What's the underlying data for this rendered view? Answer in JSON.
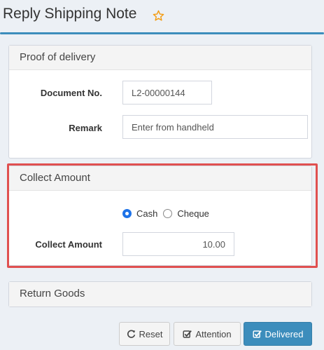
{
  "header": {
    "title": "Reply Shipping Note",
    "favorite_icon": "star-icon"
  },
  "proof": {
    "title": "Proof of delivery",
    "document_no_label": "Document No.",
    "document_no_value": "L2-00000144",
    "remark_label": "Remark",
    "remark_placeholder": "Enter from handheld"
  },
  "collect": {
    "title": "Collect Amount",
    "options": [
      "Cash",
      "Cheque"
    ],
    "selected": "Cash",
    "amount_label": "Collect Amount",
    "amount_value": "10.00"
  },
  "return_goods": {
    "title": "Return Goods"
  },
  "actions": {
    "reset_label": "Reset",
    "attention_label": "Attention",
    "delivered_label": "Delivered"
  },
  "colors": {
    "accent": "#3c8dbc",
    "highlight": "#e05050",
    "favorite": "#f39c12"
  }
}
